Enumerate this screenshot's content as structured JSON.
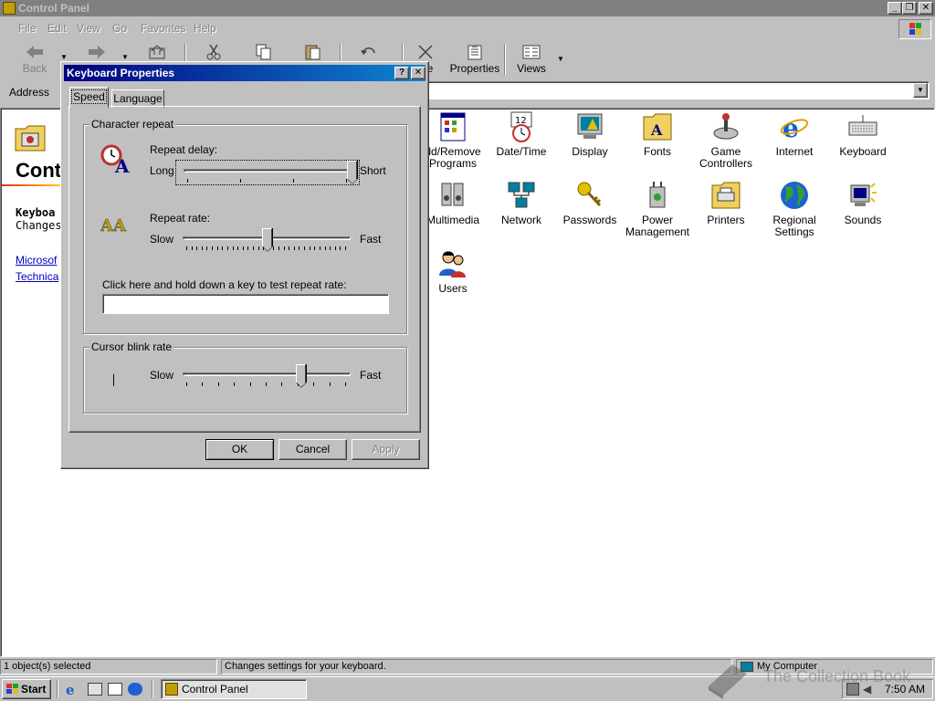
{
  "main_window": {
    "title": "Control Panel"
  },
  "menu": {
    "file": "File",
    "edit": "Edit",
    "view": "View",
    "go": "Go",
    "favorites": "Favorites",
    "help": "Help"
  },
  "toolbar": {
    "back": "Back",
    "delete_partial": "ete",
    "properties": "Properties",
    "views": "Views"
  },
  "address": {
    "label": "Address"
  },
  "left_panel": {
    "title_partial": "Cont",
    "selected_name_partial": "Keyboa",
    "selected_desc_partial": "Changes",
    "link1_partial": "Microsof",
    "link2_partial": "Technica"
  },
  "icons": [
    {
      "label": "dd/Remove Programs",
      "icon": "add-remove-programs-icon"
    },
    {
      "label": "Date/Time",
      "icon": "date-time-icon"
    },
    {
      "label": "Display",
      "icon": "display-icon"
    },
    {
      "label": "Fonts",
      "icon": "fonts-icon"
    },
    {
      "label": "Game Controllers",
      "icon": "game-controllers-icon"
    },
    {
      "label": "Internet",
      "icon": "internet-icon"
    },
    {
      "label": "Keyboard",
      "icon": "keyboard-icon"
    },
    {
      "label": "Multimedia",
      "icon": "multimedia-icon"
    },
    {
      "label": "Network",
      "icon": "network-icon"
    },
    {
      "label": "Passwords",
      "icon": "passwords-icon"
    },
    {
      "label": "Power Management",
      "icon": "power-management-icon"
    },
    {
      "label": "Printers",
      "icon": "printers-icon"
    },
    {
      "label": "Regional Settings",
      "icon": "regional-settings-icon"
    },
    {
      "label": "Sounds",
      "icon": "sounds-icon"
    },
    {
      "label": "Users",
      "icon": "users-icon"
    }
  ],
  "dialog": {
    "title": "Keyboard Properties",
    "tabs": {
      "speed": "Speed",
      "language": "Language"
    },
    "character_repeat": {
      "group_label": "Character repeat",
      "repeat_delay_label": "Repeat delay:",
      "delay_min": "Long",
      "delay_max": "Short",
      "delay_level": 1.0,
      "repeat_rate_label": "Repeat rate:",
      "rate_min": "Slow",
      "rate_max": "Fast",
      "rate_level": 0.5,
      "test_label": "Click here and hold down a key to test repeat rate:",
      "test_value": ""
    },
    "cursor_blink": {
      "group_label": "Cursor blink rate",
      "min": "Slow",
      "max": "Fast",
      "level": 0.7
    },
    "buttons": {
      "ok": "OK",
      "cancel": "Cancel",
      "apply": "Apply"
    }
  },
  "statusbar": {
    "selection": "1 object(s) selected",
    "description": "Changes settings for your keyboard.",
    "zone": "My Computer"
  },
  "taskbar": {
    "start": "Start",
    "task_control_panel": "Control Panel",
    "clock": "7:50 AM"
  },
  "watermark": {
    "text": "The Collection Book"
  }
}
